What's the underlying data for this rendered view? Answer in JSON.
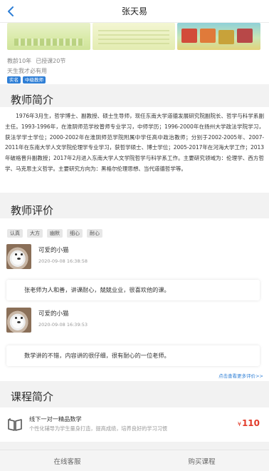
{
  "header": {
    "title": "张天易"
  },
  "profile": {
    "teaching_years": "教龄10年",
    "lessons_taught": "已授课20节",
    "motto": "天生我才必有用",
    "tags": [
      "实名",
      "中级教师"
    ]
  },
  "intro": {
    "title": "教师简介",
    "text": "1976年3月生，哲学博士、副教授、硕士生导师，现任东南大学道德发展研究院副院长、哲学与科学系副主任。1993-1996年，在淮阴师范学校普师专业学习，中师学历；1996-2000年在扬州大学政法学院学习，获法学学士学位；2000-2002年在淮阴师范学院附属中学任高中政治教师；分别于2002-2005年、2007-2011年在东南大学人文学院伦理学专业学习，获哲学硕士、博士学位；2005-2017年在河海大学工作；2013年破格晋升副教授；2017年2月进入东南大学人文学院哲学与科学系工作。主要研究领域为：伦理学、西方哲学、马克思主义哲学。主要研究方向为：黑格尔伦理思想、当代道德哲学等。"
  },
  "reviews": {
    "title": "教师评价",
    "chips": [
      "认真",
      "大方",
      "幽默",
      "细心",
      "耐心"
    ],
    "items": [
      {
        "name": "可爱的小猫",
        "time": "2020-09-08 16:38:58",
        "comment": "张老师为人和善，讲课耐心，兢兢业业，很喜欢他的课。"
      },
      {
        "name": "可爱的小猫",
        "time": "2020-09-08 16:39:53",
        "comment": "数学讲的不错，内容讲的很仔细，很有耐心的一位老师。"
      }
    ],
    "more": "点击查看更多评价>>"
  },
  "course": {
    "section_title": "课程简介",
    "title": "线下一对一精品数学",
    "desc": "个性化辅导为学生量身打造，提高成绩，培养良好的学习习惯",
    "currency": "¥",
    "price": "110"
  },
  "bottom": {
    "service": "在线客服",
    "buy": "购买课程"
  },
  "colors": {
    "accent": "#2f7fd6",
    "price": "#e23b2a"
  }
}
